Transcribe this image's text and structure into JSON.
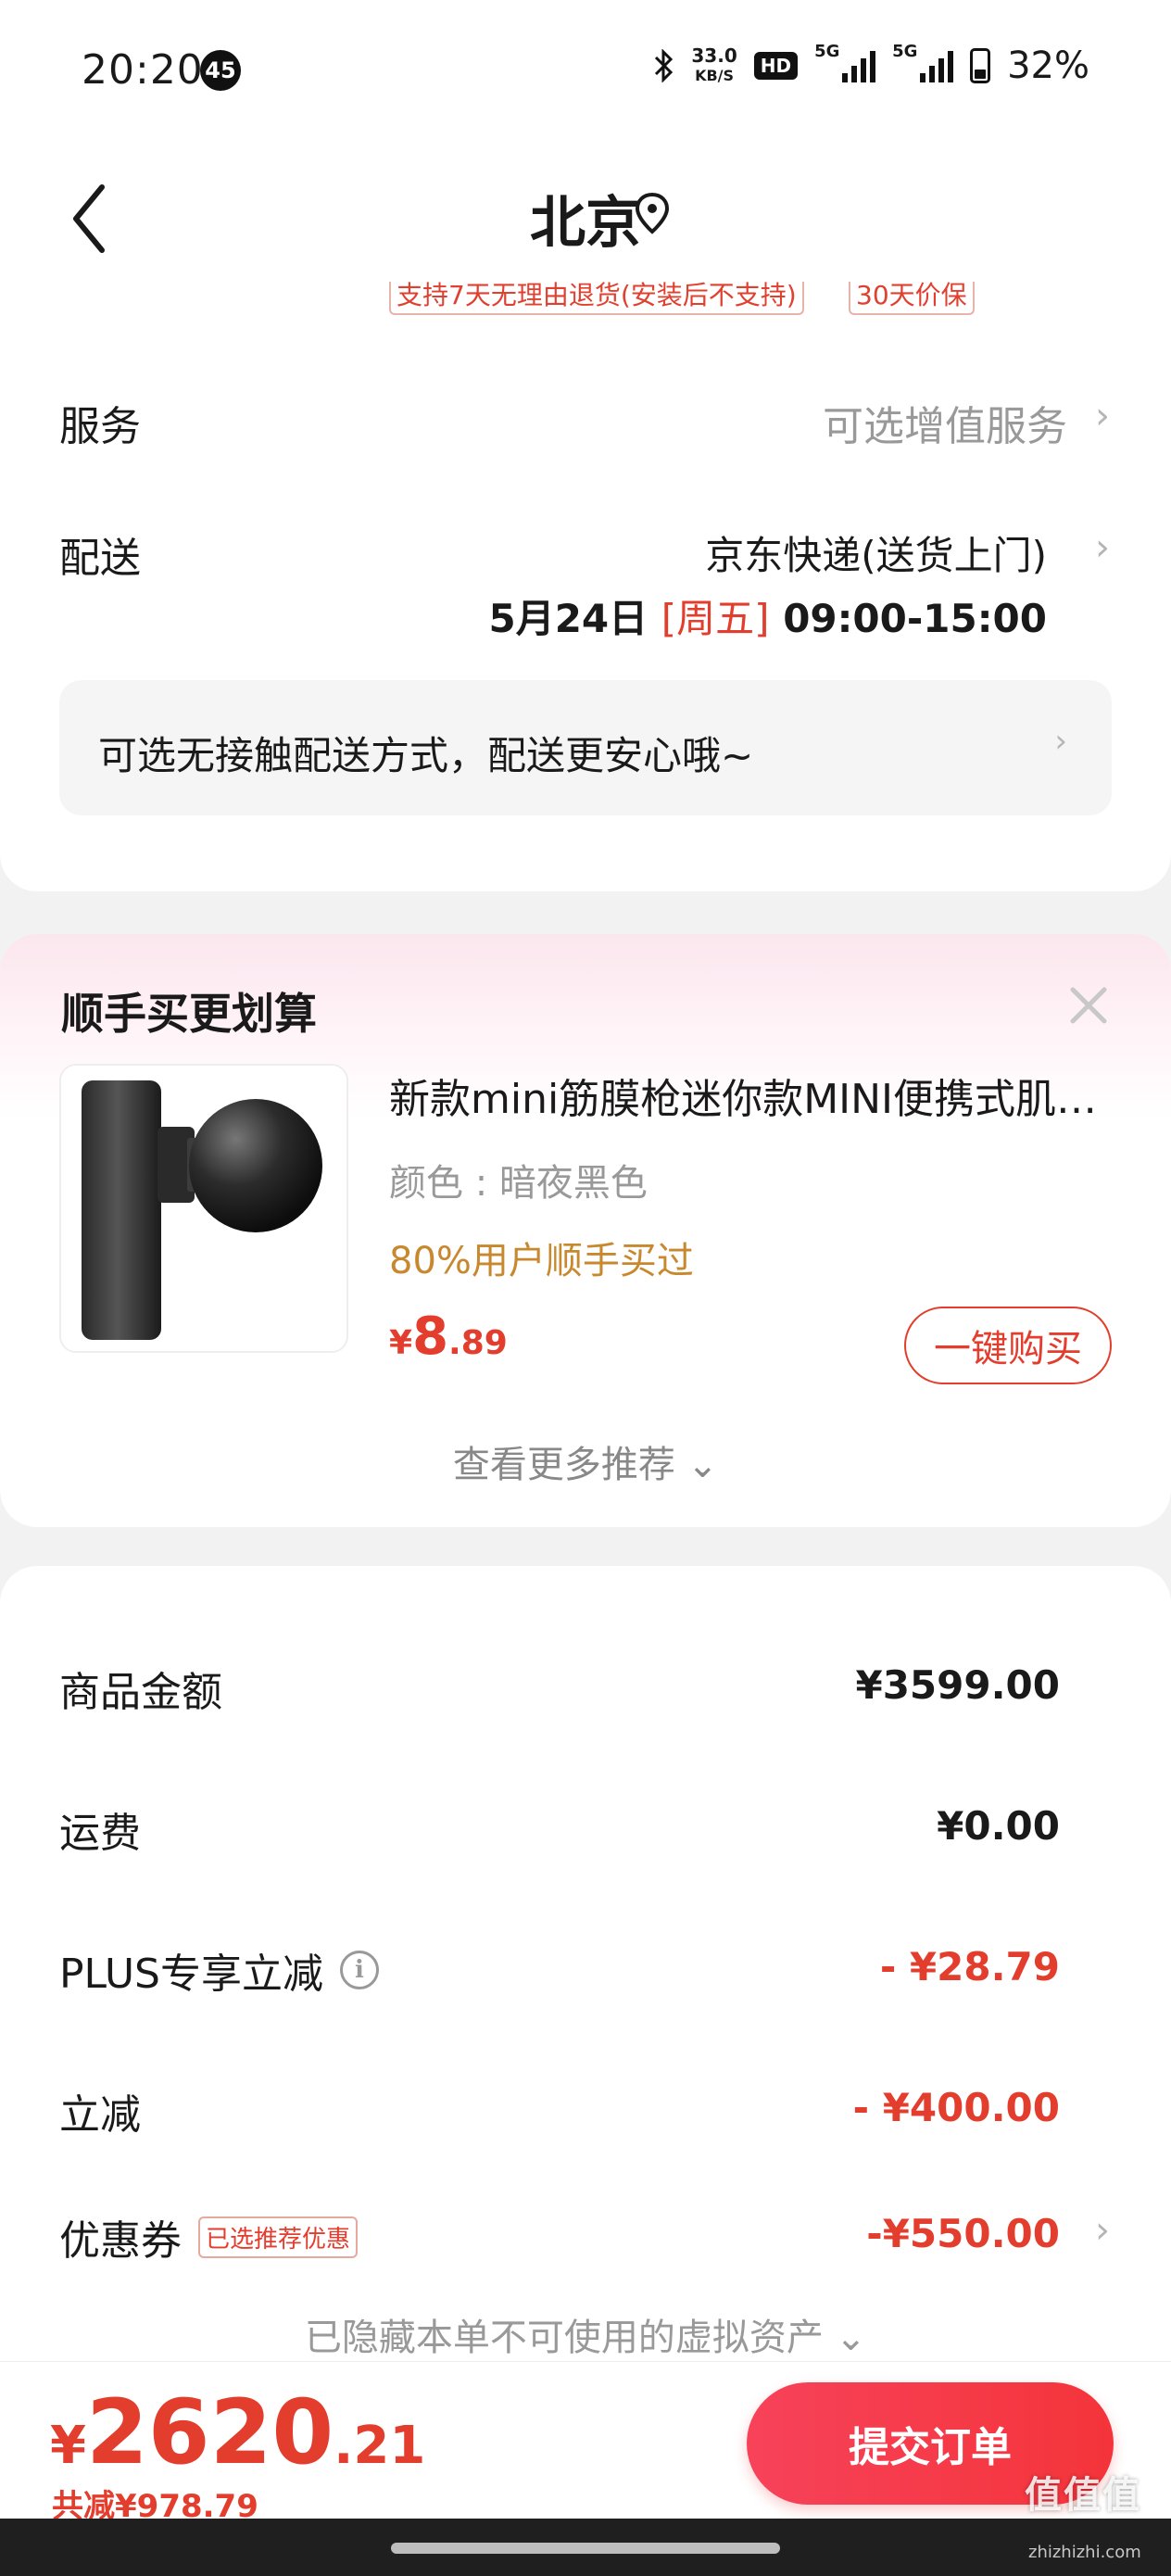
{
  "status_bar": {
    "time": "20:20",
    "badge": "45",
    "speed_value": "33.0",
    "speed_unit": "KB/S",
    "hd": "HD",
    "sig1": "5G",
    "sig2": "5G",
    "battery": "32%"
  },
  "header": {
    "title": "北京"
  },
  "service_tags": [
    "支持7天无理由退货(安装后不支持)",
    "30天价保"
  ],
  "service": {
    "label": "服务",
    "value": "可选增值服务"
  },
  "delivery": {
    "label": "配送",
    "carrier": "京东快递(送货上门)",
    "date": "5月24日",
    "weekday": "[周五]",
    "time": "09:00-15:00"
  },
  "contactless": {
    "text": "可选无接触配送方式，配送更安心哦~"
  },
  "recommend": {
    "title": "顺手买更划算",
    "product": {
      "name": "新款mini筋膜枪迷你款MINI便携式肌肉按摩器",
      "spec": "颜色 : 暗夜黑色",
      "hot": "80%用户顺手买过",
      "price_symbol": "¥",
      "price_int": "8",
      "price_dec": ".89"
    },
    "buy_label": "一键购买",
    "more_label": "查看更多推荐 ⌄"
  },
  "fees": {
    "goods_label": "商品金额",
    "goods_value": "¥3599.00",
    "shipping_label": "运费",
    "shipping_value": "¥0.00",
    "plus_label": "PLUS专享立减",
    "plus_value": "- ¥28.79",
    "discount_label": "立减",
    "discount_value": "- ¥400.00",
    "coupon_label": "优惠券",
    "coupon_tag": "已选推荐优惠",
    "coupon_value": "-¥550.00",
    "hidden_assets": "已隐藏本单不可使用的虚拟资产 ⌄"
  },
  "footer": {
    "total_symbol": "¥",
    "total_int": "2620",
    "total_dec": ".21",
    "saved": "共减¥978.79",
    "submit_label": "提交订单",
    "watermark": "值值值",
    "watermark_sub": "zhizhizhi.com"
  },
  "colors": {
    "accent_red": "#e33d2d",
    "hot_orange": "#c8882e",
    "muted_gray": "#999999"
  }
}
